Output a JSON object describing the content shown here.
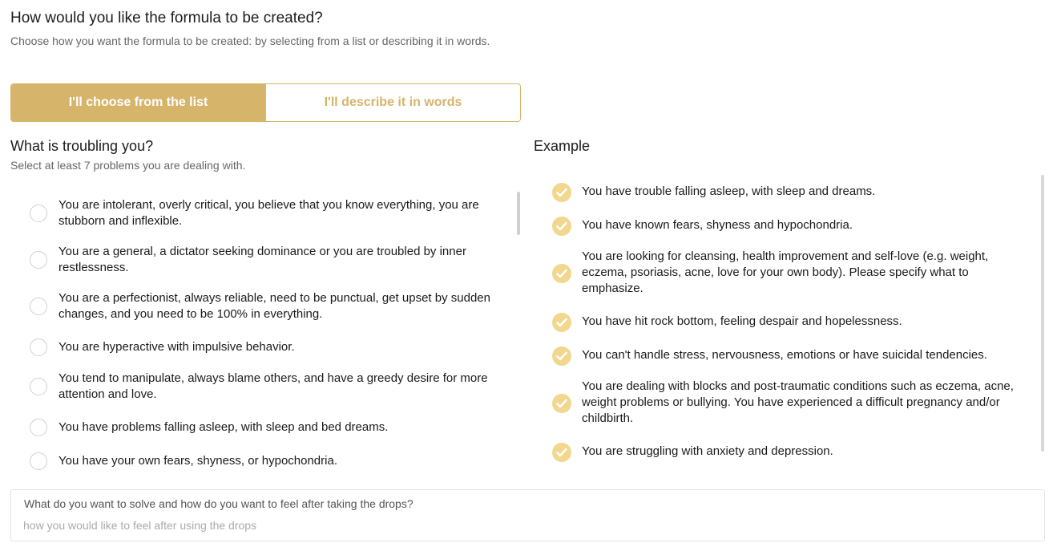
{
  "header": {
    "title": "How would you like the formula to be created?",
    "subtitle": "Choose how you want the formula to be created: by selecting from a list or describing it in words."
  },
  "toggle": {
    "choose_label": "I'll choose from the list",
    "describe_label": "I'll describe it in words"
  },
  "problems": {
    "heading": "What is troubling you?",
    "subheading": "Select at least 7 problems you are dealing with.",
    "items": [
      {
        "label": "You are intolerant, overly critical, you believe that you know everything, you are stubborn and inflexible."
      },
      {
        "label": "You are a general, a dictator seeking dominance or you are troubled by inner restlessness."
      },
      {
        "label": "You are a perfectionist, always reliable, need to be punctual, get upset by sudden changes, and you need to be 100% in everything."
      },
      {
        "label": "You are hyperactive with impulsive behavior."
      },
      {
        "label": "You tend to manipulate, always blame others, and have a greedy desire for more attention and love."
      },
      {
        "label": "You have problems falling asleep, with sleep and bed dreams."
      },
      {
        "label": "You have your own fears, shyness, or hypochondria."
      }
    ]
  },
  "example": {
    "heading": "Example",
    "items": [
      {
        "label": "You have trouble falling asleep, with sleep and dreams."
      },
      {
        "label": "You have known fears, shyness and hypochondria."
      },
      {
        "label": "You are looking for cleansing, health improvement and self-love (e.g. weight, eczema, psoriasis, acne, love for your own body). Please specify what to emphasize."
      },
      {
        "label": "You have hit rock bottom, feeling despair and hopelessness."
      },
      {
        "label": "You can't handle stress, nervousness, emotions or have suicidal tendencies."
      },
      {
        "label": "You are dealing with blocks and post-traumatic conditions such as eczema, acne, weight problems or bullying. You have experienced a difficult pregnancy and/or childbirth."
      },
      {
        "label": "You are struggling with anxiety and depression."
      }
    ]
  },
  "feeling_field": {
    "label": "What do you want to solve and how do you want to feel after taking the drops?",
    "placeholder": "how you would like to feel after using the drops",
    "value": ""
  },
  "colors": {
    "accent": "#d6b46a",
    "check_bg": "#f2d78f"
  },
  "icons": {
    "radio": "radio-empty-icon",
    "check": "checkmark-circle-icon"
  }
}
